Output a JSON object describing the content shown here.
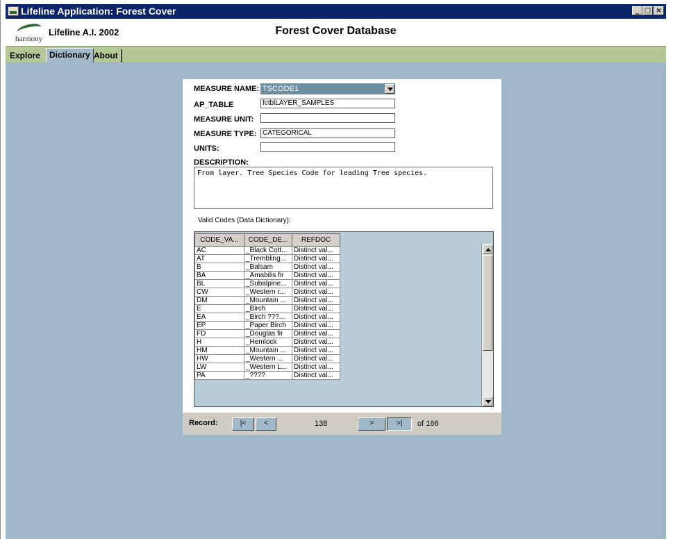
{
  "window": {
    "title": "Lifeline Application: Forest Cover",
    "controls": [
      "_",
      "□",
      "×"
    ]
  },
  "header": {
    "logo_text": "harmony",
    "app_name": "Lifeline A.I. 2002",
    "title": "Forest Cover Database"
  },
  "tabs": [
    {
      "label": "Explore",
      "active": false
    },
    {
      "label": "Dictionary",
      "active": true
    },
    {
      "label": "About",
      "active": false
    }
  ],
  "form": {
    "measure_name_label": "MEASURE NAME:",
    "measure_name_value": "TSCODE1",
    "ap_table_label": "AP_TABLE",
    "ap_table_value": "fctblLAYER_SAMPLES",
    "measure_unit_label": "MEASURE UNIT:",
    "measure_unit_value": "",
    "measure_type_label": "MEASURE TYPE:",
    "measure_type_value": "CATEGORICAL",
    "units_label": "UNITS:",
    "units_value": "",
    "description_label": "DESCRIPTION:",
    "description_value": "From layer. Tree Species Code for leading Tree species."
  },
  "codes": {
    "label": "Valid Codes (Data Dictionary):",
    "headers": [
      "CODE_VA...",
      "CODE_DE...",
      "REFDOC"
    ],
    "rows": [
      [
        "AC",
        "_Black Cott...",
        "Distinct val..."
      ],
      [
        "AT",
        "_Trembling...",
        "Distinct val..."
      ],
      [
        "B",
        "_Balsam",
        "Distinct val..."
      ],
      [
        "BA",
        "_Amabilis fir",
        "Distinct val..."
      ],
      [
        "BL",
        "_Subalpine...",
        "Distinct val..."
      ],
      [
        "CW",
        "_Western r...",
        "Distinct val..."
      ],
      [
        "DM",
        "_Mountain ...",
        "Distinct val..."
      ],
      [
        "E",
        "_Birch",
        "Distinct val..."
      ],
      [
        "EA",
        "_Birch ???...",
        "Distinct val..."
      ],
      [
        "EP",
        "_Paper Birch",
        "Distinct val..."
      ],
      [
        "FD",
        "_Douglas fir",
        "Distinct val..."
      ],
      [
        "H",
        "_Hemlock",
        "Distinct val..."
      ],
      [
        "HM",
        "_Mountain ...",
        "Distinct val..."
      ],
      [
        "HW",
        "_Western ...",
        "Distinct val..."
      ],
      [
        "LW",
        "_Western L...",
        "Distinct val..."
      ],
      [
        "PA",
        "_????",
        "Distinct val..."
      ]
    ]
  },
  "nav": {
    "record_label": "Record:",
    "first_label": "|<",
    "prev_label": "<",
    "current": "138",
    "next_label": ">",
    "last_label": ">|",
    "of_label": "of  166"
  },
  "colors": {
    "titlebar": "#0a246a",
    "background": "#a0b8c8",
    "tabbar": "#b4c896",
    "select": "#6e8ea2"
  }
}
